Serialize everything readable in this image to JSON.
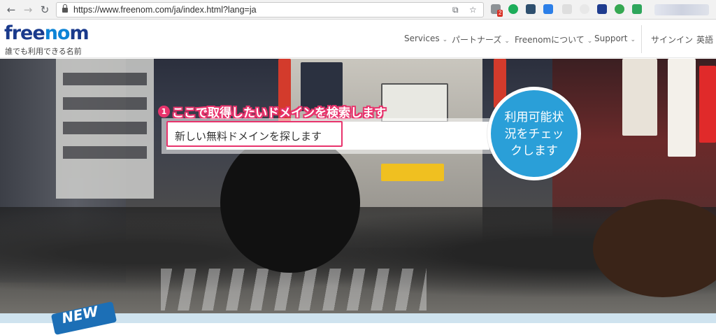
{
  "browser": {
    "url": "https://www.freenom.com/ja/index.html?lang=ja",
    "ext_badge": "2"
  },
  "header": {
    "logo_text_start": "free",
    "logo_text_oo": "no",
    "logo_text_end": "m",
    "tagline": "誰でも利用できる名前",
    "nav": {
      "services": "Services",
      "partners": "パートナーズ",
      "about": "Freenomについて",
      "support": "Support",
      "signin": "サインイン",
      "language": "英語"
    }
  },
  "hero": {
    "annotation_number": "1",
    "annotation_text": "ここで取得したいドメインを検索します",
    "search_placeholder": "新しい無料ドメインを探します",
    "check_button_line1": "利用可能状",
    "check_button_line2": "況をチェッ",
    "check_button_line3": "クします",
    "badge_text": "NEW"
  },
  "colors": {
    "accent_pink": "#e8336c",
    "check_blue": "#2a9fd8",
    "logo_navy": "#1a3a8c",
    "logo_blue": "#0d84d6"
  }
}
